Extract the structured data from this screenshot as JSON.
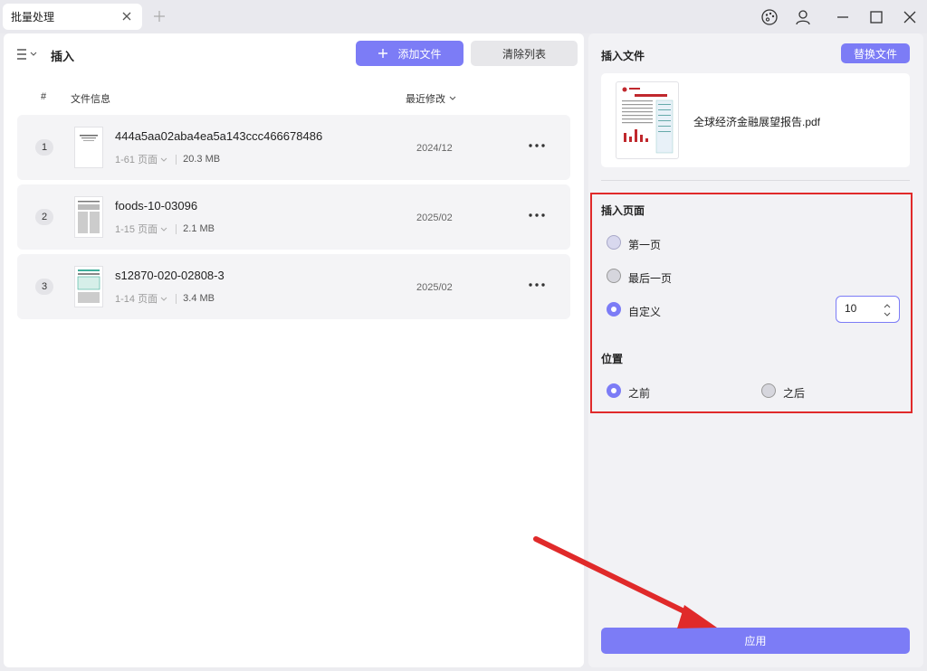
{
  "window": {
    "tab_title": "批量处理"
  },
  "toolbar": {
    "mode_title": "插入",
    "add_file_label": "添加文件",
    "clear_list_label": "清除列表"
  },
  "table": {
    "col_number": "#",
    "col_file_info": "文件信息",
    "col_modified": "最近修改"
  },
  "files": [
    {
      "index": "1",
      "name": "444a5aa02aba4ea5a143ccc466678486",
      "pages": "1-61 页面",
      "size": "20.3 MB",
      "date": "2024/12"
    },
    {
      "index": "2",
      "name": "foods-10-03096",
      "pages": "1-15 页面",
      "size": "2.1 MB",
      "date": "2025/02"
    },
    {
      "index": "3",
      "name": "s12870-020-02808-3",
      "pages": "1-14 页面",
      "size": "3.4 MB",
      "date": "2025/02"
    }
  ],
  "insert_file": {
    "title": "插入文件",
    "replace_label": "替换文件",
    "file_name": "全球经济金融展望报告.pdf"
  },
  "insert_page": {
    "title": "插入页面",
    "options": [
      "第一页",
      "最后一页",
      "自定义"
    ],
    "selected": "自定义",
    "custom_value": "10"
  },
  "position": {
    "title": "位置",
    "options": [
      "之前",
      "之后"
    ],
    "selected": "之前"
  },
  "apply_label": "应用",
  "colors": {
    "accent": "#7c7cf6",
    "highlight": "#e02a2a"
  }
}
